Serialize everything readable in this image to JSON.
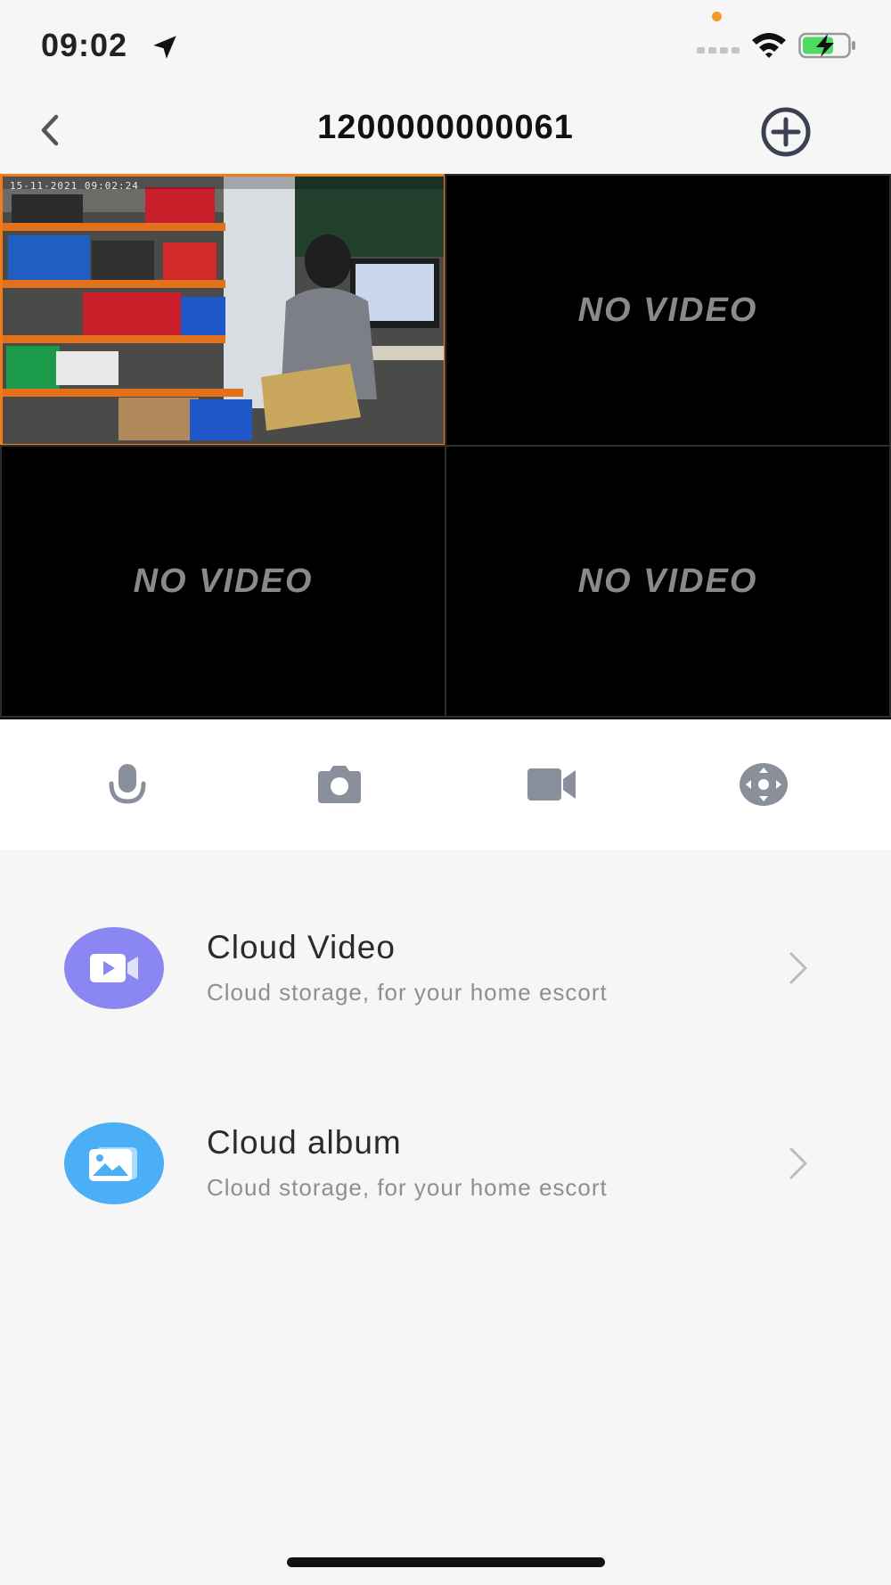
{
  "status_bar": {
    "time": "09:02",
    "icons": [
      "location-arrow-icon",
      "cellular-signal-icon",
      "wifi-icon",
      "battery-charging-icon"
    ]
  },
  "nav": {
    "title": "1200000000061",
    "back_icon": "chevron-left-icon",
    "add_icon": "plus-circle-icon"
  },
  "video_grid": {
    "camera_timestamp": "15-11-2021  09:02:24",
    "cells": [
      {
        "label": "",
        "state": "live"
      },
      {
        "label": "NO VIDEO",
        "state": "empty"
      },
      {
        "label": "NO VIDEO",
        "state": "empty"
      },
      {
        "label": "NO VIDEO",
        "state": "empty"
      }
    ]
  },
  "controls": {
    "items": [
      "microphone-icon",
      "camera-icon",
      "video-camera-icon",
      "ptz-direction-icon"
    ]
  },
  "menu": {
    "items": [
      {
        "title": "Cloud Video",
        "subtitle": "Cloud storage, for your home escort",
        "icon": "cloud-video-icon",
        "color": "#8b87f2"
      },
      {
        "title": "Cloud album",
        "subtitle": "Cloud storage, for your home escort",
        "icon": "cloud-album-icon",
        "color": "#4aaff5"
      }
    ]
  },
  "colors": {
    "accent_border": "#f07c1a",
    "icon_gray": "#8a8f9c",
    "battery_green": "#4cd964"
  }
}
